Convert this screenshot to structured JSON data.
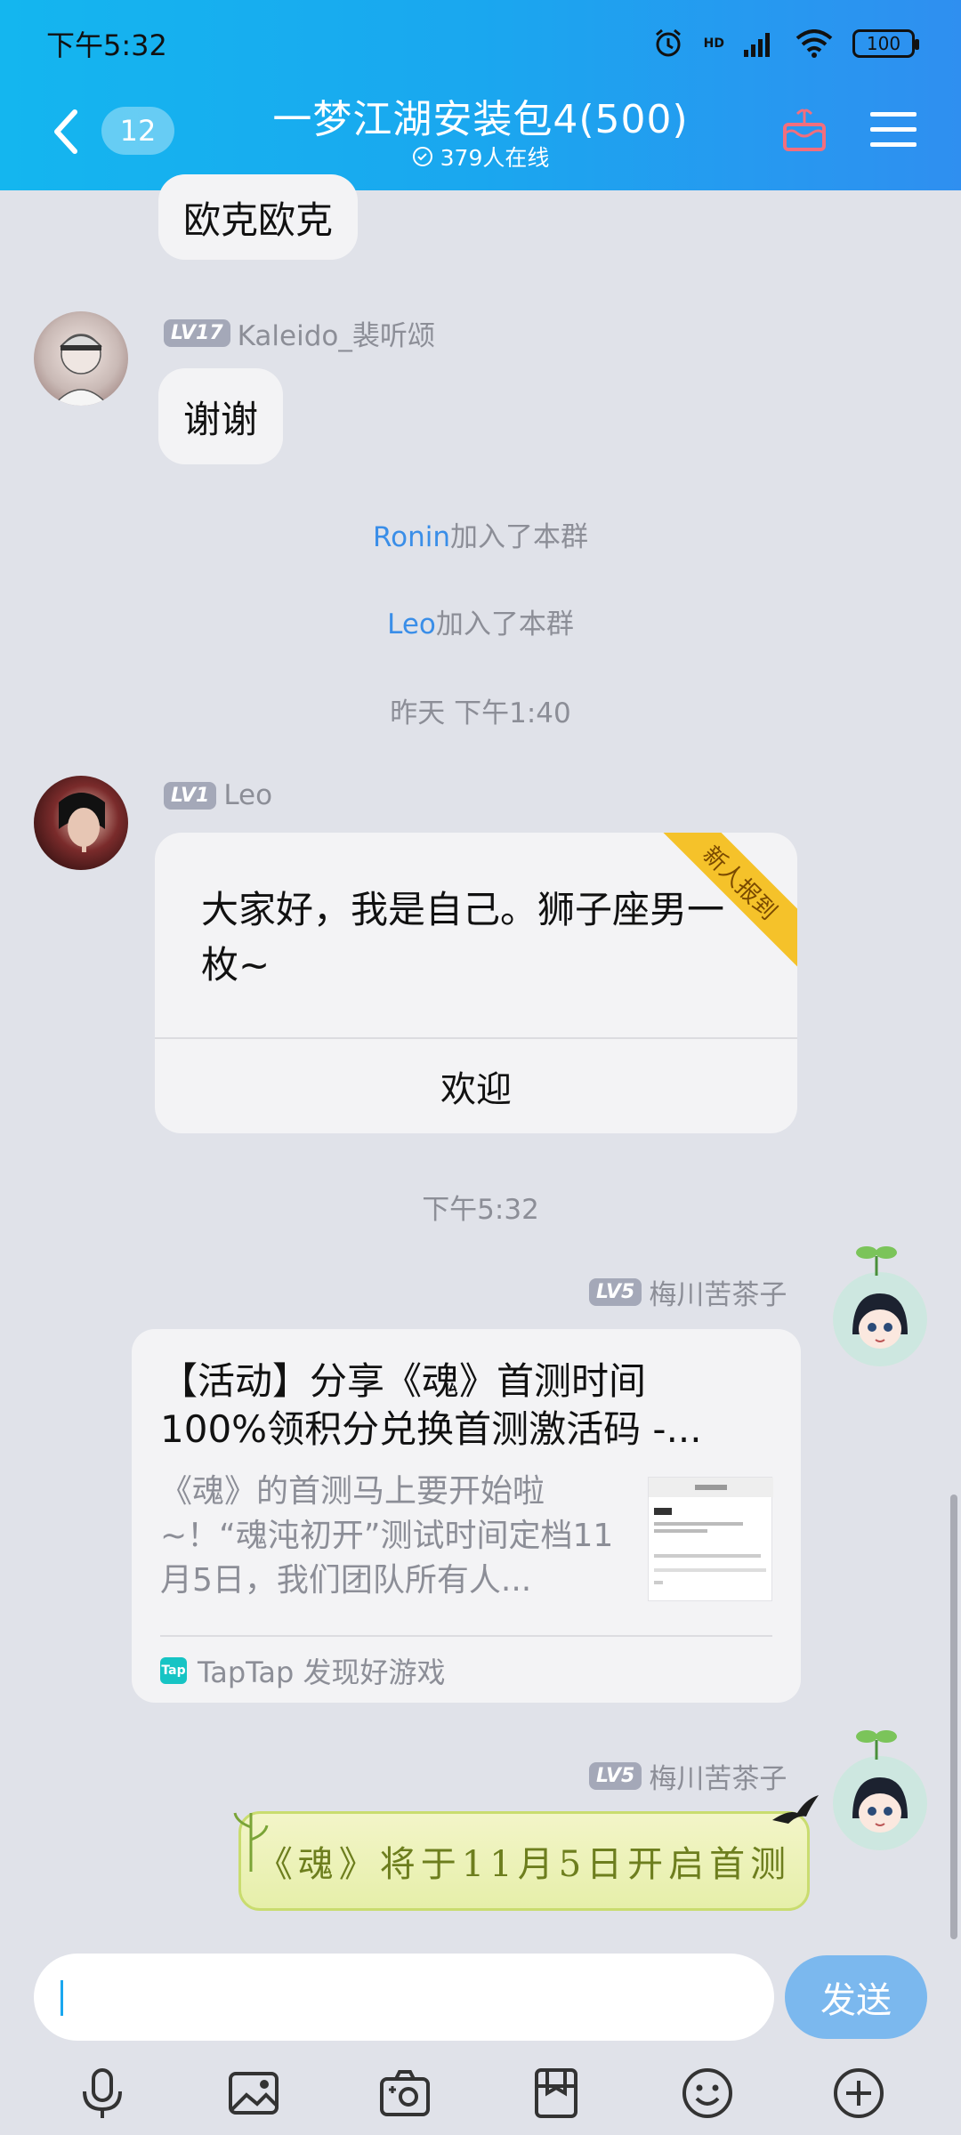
{
  "status_bar": {
    "time": "下午5:32",
    "battery": "100",
    "network": "HD"
  },
  "header": {
    "unread_count": "12",
    "title": "一梦江湖安装包4(500)",
    "online": "379人在线"
  },
  "messages": {
    "partial_bubble": "欧克欧克",
    "kaleido": {
      "level": "LV17",
      "name": "Kaleido_裴听颂",
      "text": "谢谢"
    },
    "sys_join_1": {
      "user": "Ronin",
      "suffix": "加入了本群"
    },
    "sys_join_2": {
      "user": "Leo",
      "suffix": "加入了本群"
    },
    "time_1": "昨天 下午1:40",
    "leo": {
      "level": "LV1",
      "name": "Leo",
      "text": "大家好，我是自己。狮子座男一枚~",
      "ribbon": "新人报到",
      "action": "欢迎"
    },
    "time_2": "下午5:32",
    "meichuan_1": {
      "level": "LV5",
      "name": "梅川苦茶子",
      "link_title": "【活动】分享《魂》首测时间\n100%领积分兑换首测激活码 -...",
      "link_desc": "《魂》的首测马上要开始啦~！“魂沌初开”测试时间定档11月5日，我们团队所有人...",
      "source": "TapTap 发现好游戏",
      "source_logo": "Tap"
    },
    "meichuan_2": {
      "level": "LV5",
      "name": "梅川苦茶子",
      "banner_text": "《魂》将于11月5日开启首测"
    }
  },
  "input": {
    "placeholder": "",
    "send_label": "发送"
  },
  "toolbar": [
    "microphone-icon",
    "image-icon",
    "camera-icon",
    "file-icon",
    "emoji-icon",
    "plus-icon"
  ],
  "colors": {
    "header_start": "#14b6ef",
    "header_end": "#2f8ff0",
    "accent": "#1aa7ef",
    "link": "#3a8ee8"
  }
}
